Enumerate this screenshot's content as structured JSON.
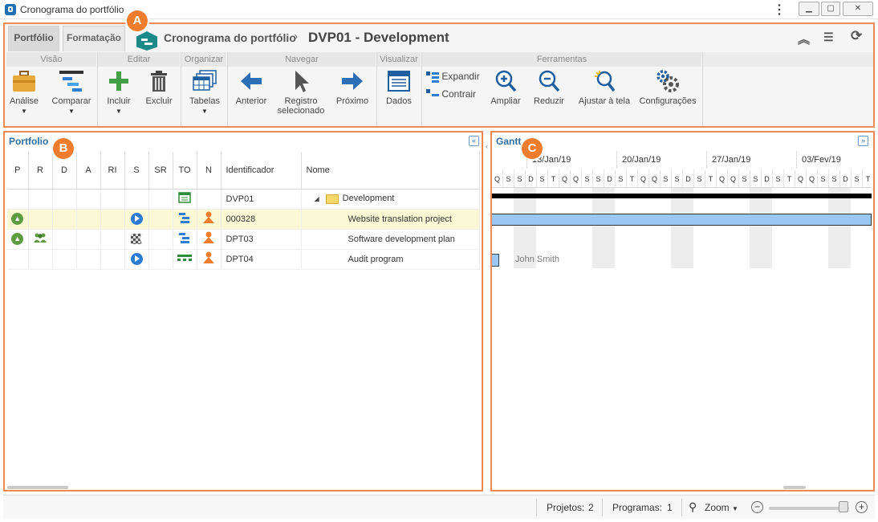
{
  "window": {
    "title": "Cronograma do portfólio"
  },
  "tabs": [
    {
      "label": "Portfólio",
      "active": true
    },
    {
      "label": "Formatação",
      "active": false
    }
  ],
  "breadcrumb": {
    "module": "Cronograma do portfólio",
    "separator": "›",
    "record": "DVP01 - Development"
  },
  "ribbon": {
    "groups": {
      "visao": "Visão",
      "editar": "Editar",
      "organizar": "Organizar",
      "navegar": "Navegar",
      "visualizar": "Visualizar",
      "ferramentas": "Ferramentas"
    },
    "buttons": {
      "analise": "Análise",
      "comparar": "Comparar",
      "incluir": "Incluir",
      "excluir": "Excluir",
      "tabelas": "Tabelas",
      "anterior": "Anterior",
      "registro_line1": "Registro",
      "registro_line2": "selecionado",
      "proximo": "Próximo",
      "dados": "Dados",
      "expandir": "Expandir",
      "contrair": "Contrair",
      "ampliar": "Ampliar",
      "reduzir": "Reduzir",
      "ajustar": "Ajustar à tela",
      "configuracoes": "Configurações"
    }
  },
  "portfolio_panel": {
    "title": "Portfolio",
    "columns": [
      "P",
      "R",
      "D",
      "A",
      "RI",
      "S",
      "SR",
      "TO",
      "N",
      "Identificador",
      "Nome"
    ],
    "rows": [
      {
        "id": "DVP01",
        "name": "Development",
        "type": "portfolio"
      },
      {
        "id": "000328",
        "name": "Website translation project",
        "type": "project",
        "selected": true
      },
      {
        "id": "DPT03",
        "name": "Software development plan",
        "type": "project"
      },
      {
        "id": "DPT04",
        "name": "Audit program",
        "type": "program"
      }
    ]
  },
  "gantt_panel": {
    "title": "Gantt",
    "weeks": [
      "13/Jan/19",
      "20/Jan/19",
      "27/Jan/19",
      "03/Fev/19"
    ],
    "days": [
      "Q",
      "S",
      "S",
      "D",
      "S",
      "T",
      "Q",
      "Q",
      "S",
      "S",
      "D",
      "S",
      "T",
      "Q",
      "Q",
      "S",
      "S",
      "D",
      "S",
      "T",
      "Q",
      "Q",
      "S",
      "S",
      "D",
      "S",
      "T",
      "Q",
      "Q",
      "S",
      "S",
      "D",
      "S",
      "T",
      "Q",
      "Q",
      "S",
      "S"
    ],
    "resource_label": "John Smith"
  },
  "status_bar": {
    "projetos_label": "Projetos:",
    "projetos_value": "2",
    "programas_label": "Programas:",
    "programas_value": "1",
    "zoom_label": "Zoom",
    "zoom_level": 0.93
  },
  "callouts": [
    "A",
    "B",
    "C"
  ],
  "colors": {
    "accent": "#2f6da3",
    "callout": "#f07d2d",
    "selected_row": "#fbf8d6",
    "gantt_bar": "#9ac8f3"
  }
}
